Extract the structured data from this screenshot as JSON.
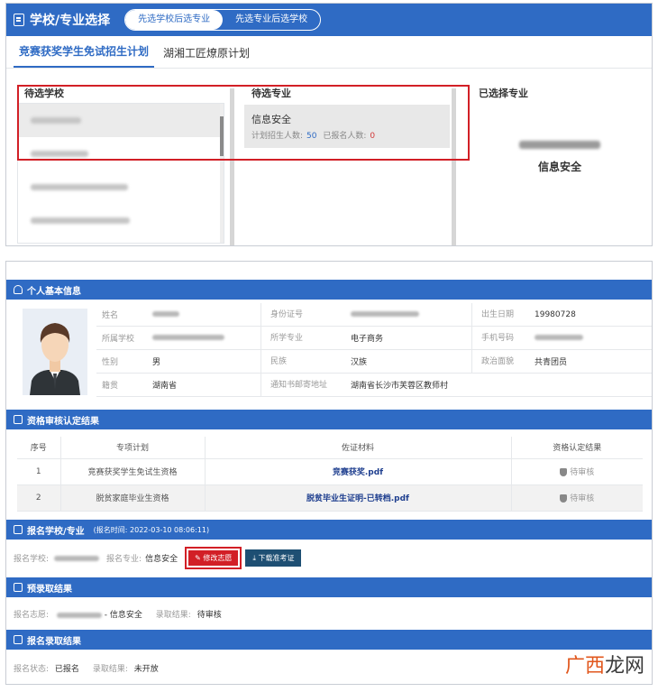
{
  "top": {
    "title": "学校/专业选择",
    "toggle": [
      "先选学校后选专业",
      "先选专业后选学校"
    ],
    "tabs": [
      "竞赛获奖学生免试招生计划",
      "湖湘工匠燎原计划"
    ],
    "schools_header": "待选学校",
    "majors_header": "待选专业",
    "chosen_header": "已选择专业",
    "major": {
      "name": "信息安全",
      "plan_label": "计划招生人数:",
      "plan_value": "50",
      "applied_label": "已报名人数:",
      "applied_value": "0"
    },
    "chosen_major": "信息安全"
  },
  "basic": {
    "title": "个人基本信息",
    "rows": [
      [
        {
          "label": "姓名",
          "value": ""
        },
        {
          "label": "身份证号",
          "value": ""
        },
        {
          "label": "出生日期",
          "value": "19980728"
        }
      ],
      [
        {
          "label": "所属学校",
          "value": ""
        },
        {
          "label": "所学专业",
          "value": "电子商务"
        },
        {
          "label": "手机号码",
          "value": ""
        }
      ],
      [
        {
          "label": "性别",
          "value": "男"
        },
        {
          "label": "民族",
          "value": "汉族"
        },
        {
          "label": "政治面貌",
          "value": "共青团员"
        }
      ],
      [
        {
          "label": "籍贯",
          "value": "湖南省"
        },
        {
          "label": "通知书邮寄地址",
          "value": "湖南省长沙市芙蓉区教师村"
        },
        {
          "label": "",
          "value": ""
        }
      ]
    ]
  },
  "qual": {
    "title": "资格审核认定结果",
    "headers": [
      "序号",
      "专项计划",
      "佐证材料",
      "资格认定结果"
    ],
    "rows": [
      {
        "no": "1",
        "plan": "竞赛获奖学生免试生资格",
        "file": "竞赛获奖.pdf",
        "result": "待审核"
      },
      {
        "no": "2",
        "plan": "脱贫家庭毕业生资格",
        "file": "脱贫毕业生证明-已转档.pdf",
        "result": "待审核"
      }
    ]
  },
  "apply": {
    "title": "报名学校/专业",
    "time": "(报名时间: 2022-03-10 08:06:11)",
    "school_label": "报名学校:",
    "major_label": "报名专业:",
    "major_value": "信息安全",
    "edit_button": "修改志愿",
    "download_button": "下载准考证"
  },
  "pre": {
    "title": "预录取结果",
    "wish_label": "报名志愿:",
    "wish_suffix": "- 信息安全",
    "result_label": "录取结果:",
    "result_value": "待审核"
  },
  "final": {
    "title": "报名录取结果",
    "status_label": "报名状态:",
    "status_value": "已报名",
    "result_label": "录取结果:",
    "result_value": "未开放"
  },
  "watermark": {
    "part1": "广西",
    "part2": "龙网"
  }
}
